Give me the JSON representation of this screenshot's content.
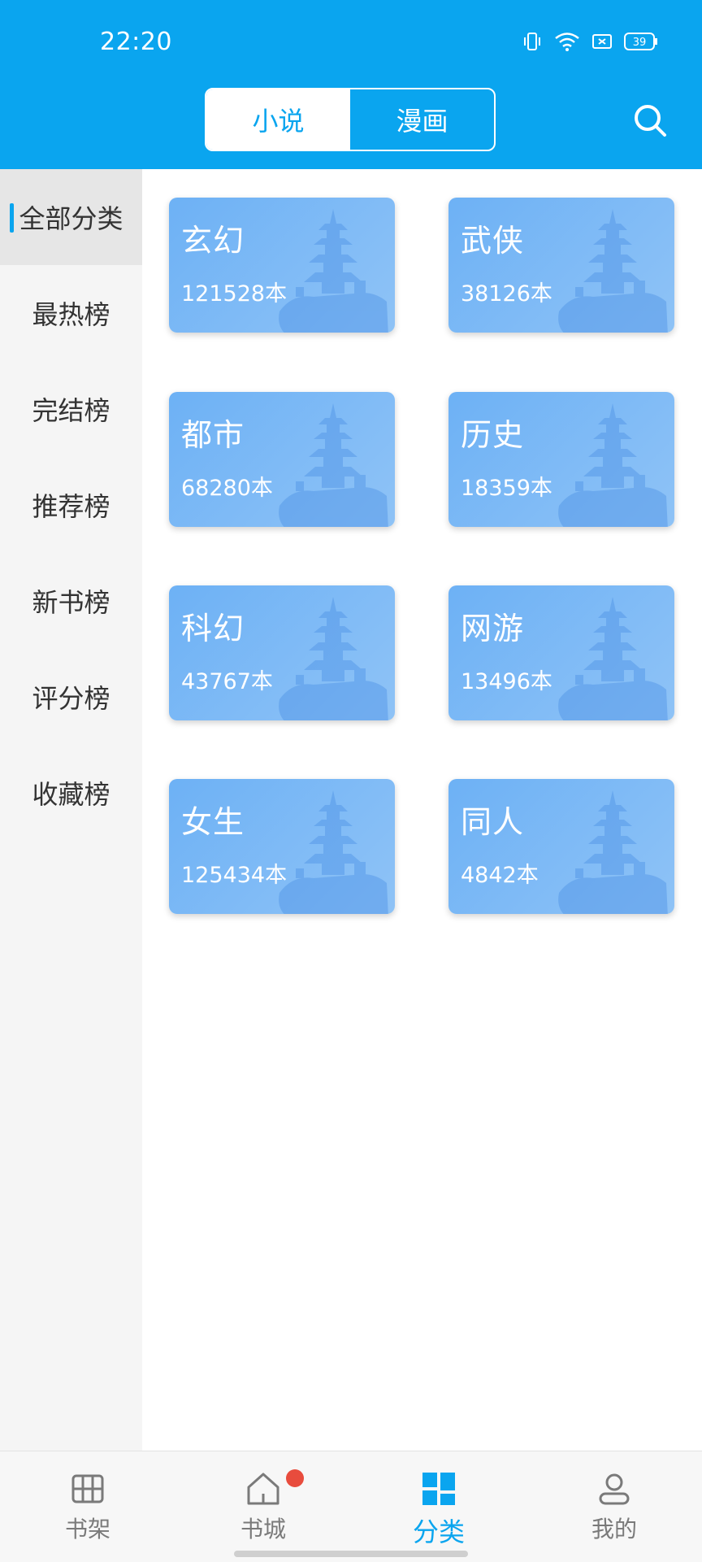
{
  "status_bar": {
    "time": "22:20",
    "battery": "39"
  },
  "top_tabs": [
    {
      "label": "小说",
      "active": true
    },
    {
      "label": "漫画",
      "active": false
    }
  ],
  "sidebar": {
    "items": [
      {
        "label": "全部分类",
        "active": true
      },
      {
        "label": "最热榜",
        "active": false
      },
      {
        "label": "完结榜",
        "active": false
      },
      {
        "label": "推荐榜",
        "active": false
      },
      {
        "label": "新书榜",
        "active": false
      },
      {
        "label": "评分榜",
        "active": false
      },
      {
        "label": "收藏榜",
        "active": false
      }
    ]
  },
  "categories": [
    {
      "name": "玄幻",
      "count": "121528本"
    },
    {
      "name": "武侠",
      "count": "38126本"
    },
    {
      "name": "都市",
      "count": "68280本"
    },
    {
      "name": "历史",
      "count": "18359本"
    },
    {
      "name": "科幻",
      "count": "43767本"
    },
    {
      "name": "网游",
      "count": "13496本"
    },
    {
      "name": "女生",
      "count": "125434本"
    },
    {
      "name": "同人",
      "count": "4842本"
    }
  ],
  "bottom_nav": [
    {
      "label": "书架",
      "icon": "bookshelf-icon",
      "active": false
    },
    {
      "label": "书城",
      "icon": "home-icon",
      "active": false,
      "badge": true
    },
    {
      "label": "分类",
      "icon": "category-icon",
      "active": true
    },
    {
      "label": "我的",
      "icon": "profile-icon",
      "active": false
    }
  ],
  "colors": {
    "primary": "#0aa5ef",
    "card": "#7ab8f5",
    "badge": "#e84c3d"
  }
}
